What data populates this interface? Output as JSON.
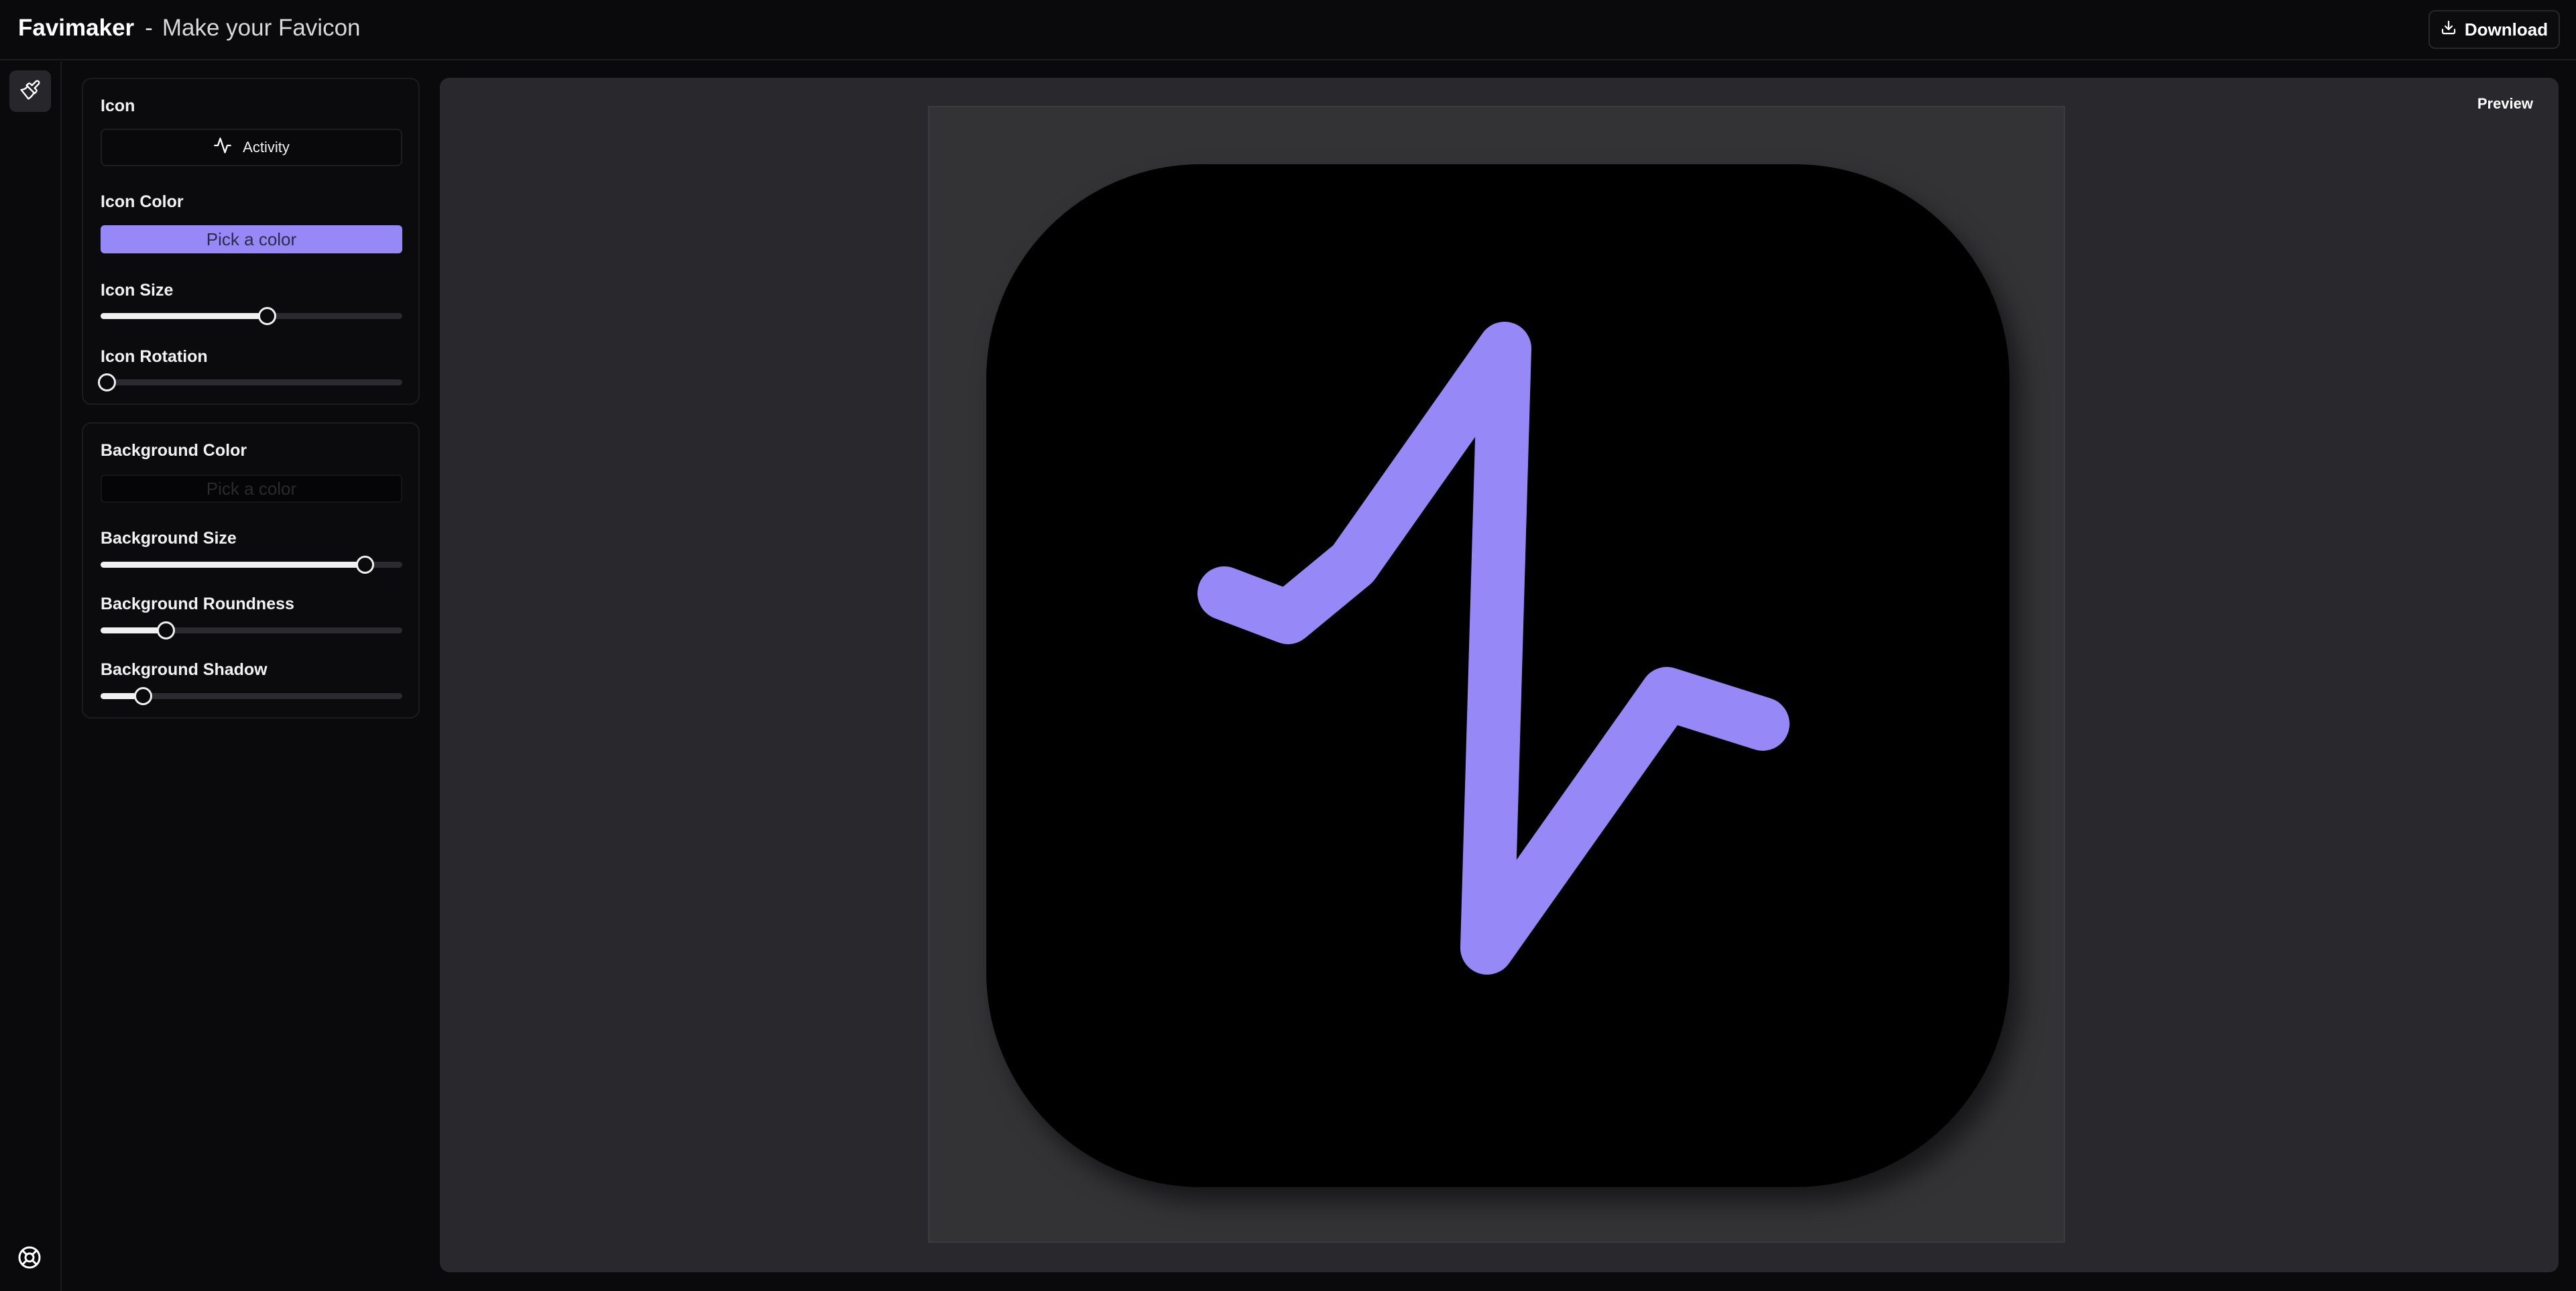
{
  "header": {
    "brand_name": "Favimaker",
    "separator": "-",
    "tagline": "Make your Favicon",
    "download_label": "Download"
  },
  "rail": {
    "tool_icon": "paintbrush-icon",
    "help_icon": "life-buoy-icon"
  },
  "icon_panel": {
    "icon_label": "Icon",
    "icon_value": "Activity",
    "icon_color_label": "Icon Color",
    "icon_color_button": "Pick a color",
    "icon_color": "#9689f7",
    "icon_size_label": "Icon Size",
    "icon_size_value": 0.55,
    "icon_rotation_label": "Icon Rotation",
    "icon_rotation_value": 0.02
  },
  "background_panel": {
    "bg_color_label": "Background Color",
    "bg_color_button": "Pick a color",
    "bg_color": "#000000",
    "bg_size_label": "Background Size",
    "bg_size_value": 0.875,
    "bg_roundness_label": "Background Roundness",
    "bg_roundness_value": 0.215,
    "bg_shadow_label": "Background Shadow",
    "bg_shadow_value": 0.14
  },
  "preview": {
    "label": "Preview"
  }
}
